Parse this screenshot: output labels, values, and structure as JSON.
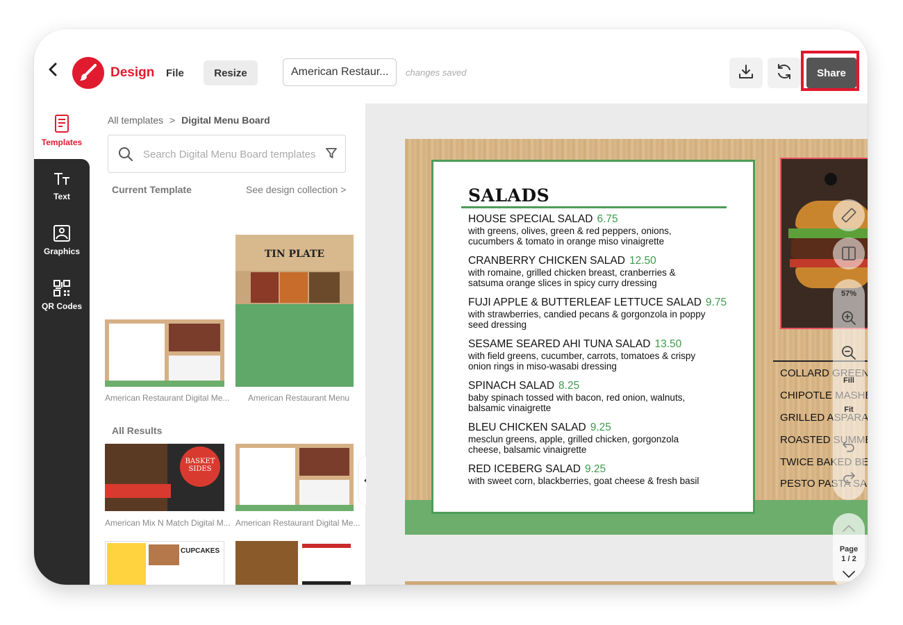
{
  "header": {
    "brand": "Design",
    "menu_file": "File",
    "menu_resize": "Resize",
    "doc_name": "American Restaur...",
    "save_status": "changes saved",
    "share_label": "Share",
    "accent_color": "#e01b2f"
  },
  "rail": {
    "items": [
      {
        "label": "Templates",
        "icon": "templates-icon"
      },
      {
        "label": "Text",
        "icon": "text-icon"
      },
      {
        "label": "Graphics",
        "icon": "graphics-icon"
      },
      {
        "label": "QR Codes",
        "icon": "qr-code-icon"
      }
    ]
  },
  "panel": {
    "breadcrumb_root": "All templates",
    "breadcrumb_sep": ">",
    "breadcrumb_current": "Digital Menu Board",
    "search_placeholder": "Search Digital Menu Board templates",
    "current_template_title": "Current Template",
    "see_collection": "See design collection >",
    "current_templates": [
      {
        "caption": "American Restaurant Digital Me..."
      },
      {
        "caption": "American Restaurant Menu",
        "thumb_title": "TIN PLATE"
      }
    ],
    "all_results_title": "All Results",
    "results": [
      {
        "caption": "American Mix N Match Digital M...",
        "thumb_title": "BASKET SIDES"
      },
      {
        "caption": "American Restaurant Digital Me..."
      },
      {
        "caption": "",
        "thumb_title": "CUPCAKES"
      },
      {
        "caption": ""
      }
    ]
  },
  "menu": {
    "title": "SALADS",
    "items": [
      {
        "name": "HOUSE SPECIAL SALAD",
        "price": "6.75",
        "desc1": "with greens, olives, green & red peppers, onions,",
        "desc2": "cucumbers & tomato in orange miso vinaigrette"
      },
      {
        "name": "CRANBERRY CHICKEN SALAD",
        "price": "12.50",
        "desc1": "with romaine, grilled chicken breast, cranberries &",
        "desc2": "satsuma orange slices in spicy curry dressing"
      },
      {
        "name": "FUJI APPLE & BUTTERLEAF LETTUCE SALAD",
        "price": "9.75",
        "desc1": "with strawberries, candied pecans & gorgonzola in poppy",
        "desc2": "seed dressing"
      },
      {
        "name": "SESAME SEARED AHI TUNA SALAD",
        "price": "13.50",
        "desc1": "with field greens, cucumber, carrots, tomatoes & crispy",
        "desc2": "onion rings in miso-wasabi dressing"
      },
      {
        "name": "SPINACH SALAD",
        "price": "8.25",
        "desc1": "baby spinach tossed with bacon, red onion, walnuts,",
        "desc2": "balsamic vinaigrette"
      },
      {
        "name": "BLEU CHICKEN SALAD",
        "price": "9.25",
        "desc1": "mesclun greens, apple, grilled chicken, gorgonzola",
        "desc2": "cheese, balsamic vinaigrette"
      },
      {
        "name": "RED ICEBERG SALAD",
        "price": "9.25",
        "desc1": "with sweet corn, blackberries, goat cheese & fresh basil",
        "desc2": ""
      }
    ],
    "sides": [
      "COLLARD GREEN",
      "CHIPOTLE MASHE",
      "GRILLED ASPARA",
      "ROASTED SUMME",
      "TWICE BAKED BE",
      "PESTO PASTA SAL"
    ]
  },
  "canvas_tools": {
    "zoom": "57%",
    "fill": "Fill",
    "fit": "Fit",
    "page_label": "Page",
    "page_number": "1 / 2"
  }
}
